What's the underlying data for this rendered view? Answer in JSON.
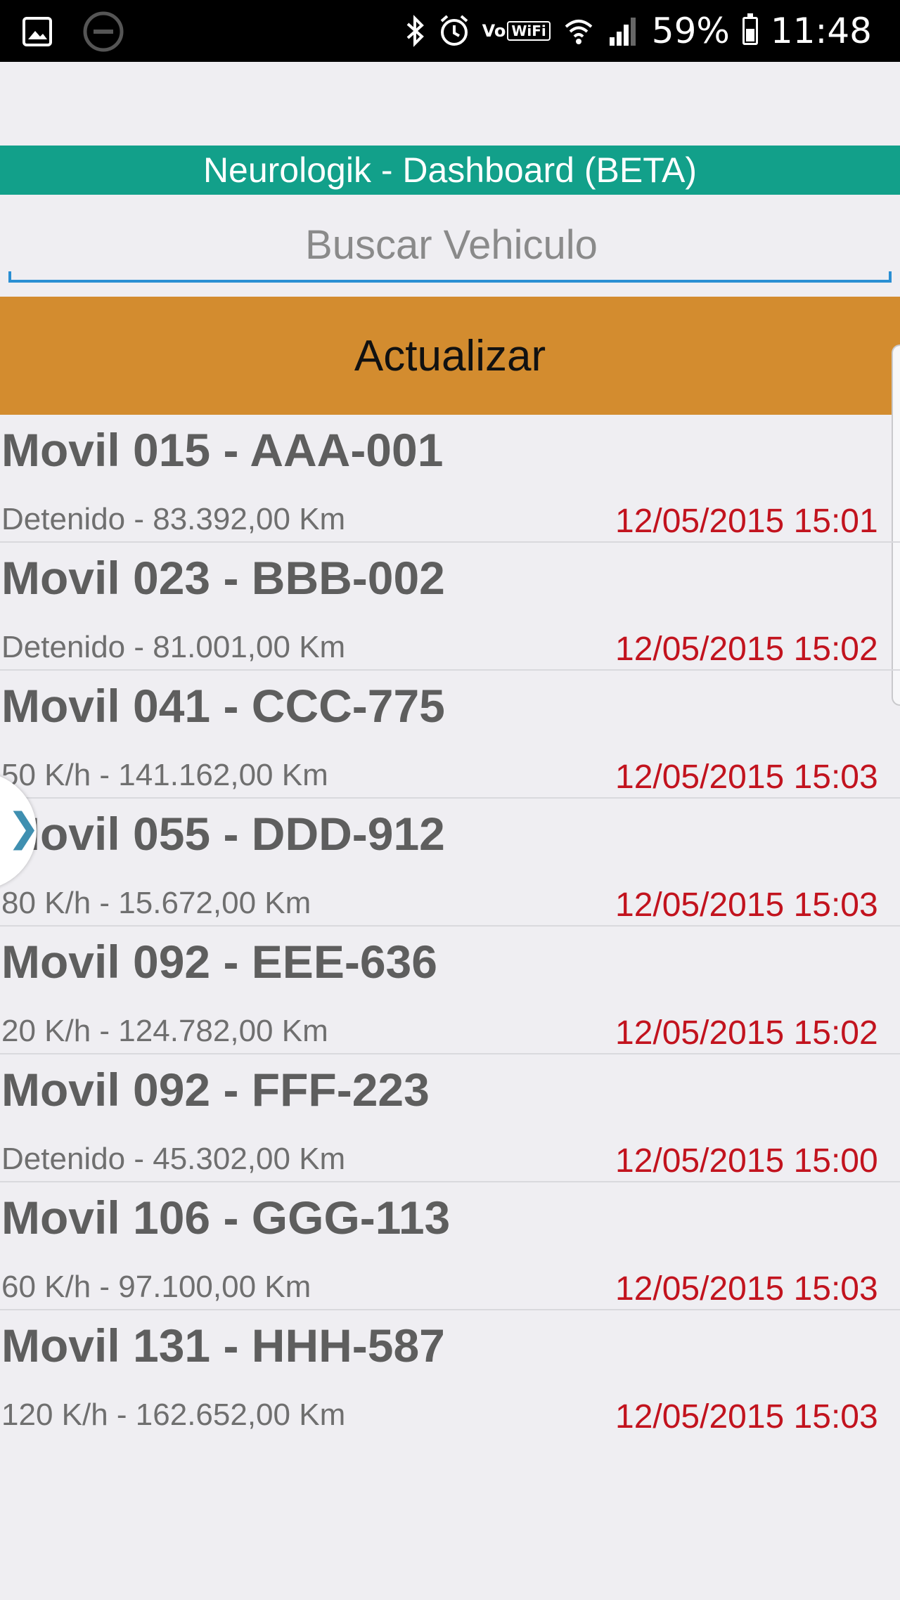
{
  "status_bar": {
    "battery": "59%",
    "time": "11:48",
    "wifi_label_a": "Vo",
    "wifi_label_b": "WiFi",
    "icons": [
      "gallery-icon",
      "minus-circle-icon",
      "bluetooth-icon",
      "alarm-icon",
      "wifi-icon",
      "signal-icon",
      "battery-icon"
    ]
  },
  "header": {
    "title": "Neurologik - Dashboard (BETA)"
  },
  "search": {
    "placeholder": "Buscar Vehiculo",
    "value": ""
  },
  "refresh": {
    "label": "Actualizar"
  },
  "vehicles": [
    {
      "title": "Movil 015 - AAA-001",
      "status": "Detenido - 83.392,00 Km",
      "time": "12/05/2015 15:01"
    },
    {
      "title": "Movil 023 - BBB-002",
      "status": "Detenido - 81.001,00 Km",
      "time": "12/05/2015 15:02"
    },
    {
      "title": "Movil 041 - CCC-775",
      "status": "50 K/h - 141.162,00 Km",
      "time": "12/05/2015 15:03"
    },
    {
      "title": "Movil 055 - DDD-912",
      "status": "80 K/h - 15.672,00 Km",
      "time": "12/05/2015 15:03"
    },
    {
      "title": "Movil 092 - EEE-636",
      "status": "20 K/h - 124.782,00 Km",
      "time": "12/05/2015 15:02"
    },
    {
      "title": "Movil 092 - FFF-223",
      "status": "Detenido - 45.302,00 Km",
      "time": "12/05/2015 15:00"
    },
    {
      "title": "Movil 106 - GGG-113",
      "status": "60 K/h - 97.100,00 Km",
      "time": "12/05/2015 15:03"
    },
    {
      "title": "Movil 131 - HHH-587",
      "status": "120 K/h - 162.652,00 Km",
      "time": "12/05/2015 15:03"
    }
  ],
  "colors": {
    "title_bar": "#12a08a",
    "refresh_button": "#d38c2f",
    "timestamp": "#c2131e",
    "search_underline": "#2a8fd3"
  }
}
